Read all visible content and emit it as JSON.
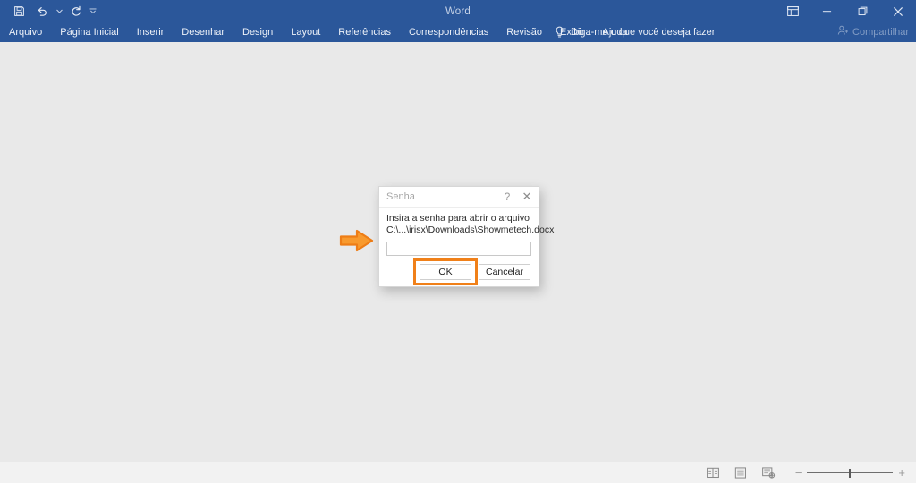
{
  "window": {
    "title": "Word",
    "quick_access": [
      {
        "name": "save-icon",
        "label": "Salvar"
      },
      {
        "name": "undo-icon",
        "label": "Desfazer"
      },
      {
        "name": "redo-icon",
        "label": "Refazer"
      },
      {
        "name": "customize-qat-icon",
        "label": "Personalizar Barra de Ferramentas de Acesso Rápido"
      }
    ],
    "controls": [
      {
        "name": "ribbon-display-options-icon",
        "label": "Opções de Exibição da Faixa de Opções"
      },
      {
        "name": "minimize-icon",
        "label": "Minimizar"
      },
      {
        "name": "restore-icon",
        "label": "Restaurar"
      },
      {
        "name": "close-icon",
        "label": "Fechar"
      }
    ],
    "colors": {
      "ribbon_blue": "#2b579a",
      "canvas_gray": "#e9e9e9",
      "accent_orange": "#f08019"
    }
  },
  "ribbon": {
    "tabs": [
      {
        "label": "Arquivo"
      },
      {
        "label": "Página Inicial"
      },
      {
        "label": "Inserir"
      },
      {
        "label": "Desenhar"
      },
      {
        "label": "Design"
      },
      {
        "label": "Layout"
      },
      {
        "label": "Referências"
      },
      {
        "label": "Correspondências"
      },
      {
        "label": "Revisão"
      },
      {
        "label": "Exibir"
      },
      {
        "label": "Ajuda"
      }
    ],
    "tell_me": "Diga-me o que você deseja fazer",
    "share": "Compartilhar"
  },
  "status_bar": {
    "views": [
      {
        "name": "read-mode-icon",
        "label": "Modo de Leitura"
      },
      {
        "name": "print-layout-icon",
        "label": "Layout de Impressão"
      },
      {
        "name": "web-layout-icon",
        "label": "Layout da Web"
      }
    ],
    "zoom": {
      "minus": "−",
      "plus": "+",
      "value": 100
    }
  },
  "dialog": {
    "title": "Senha",
    "help_glyph": "?",
    "close_glyph": "✕",
    "message_line1": "Insira a senha para abrir o arquivo",
    "message_line2": "C:\\...\\irisx\\Downloads\\Showmetech.docx",
    "password_value": "",
    "password_placeholder": "",
    "ok_label": "OK",
    "cancel_label": "Cancelar"
  },
  "annotation": {
    "arrow": {
      "name": "pointer-arrow",
      "direction": "right",
      "color": "#f08019"
    }
  }
}
